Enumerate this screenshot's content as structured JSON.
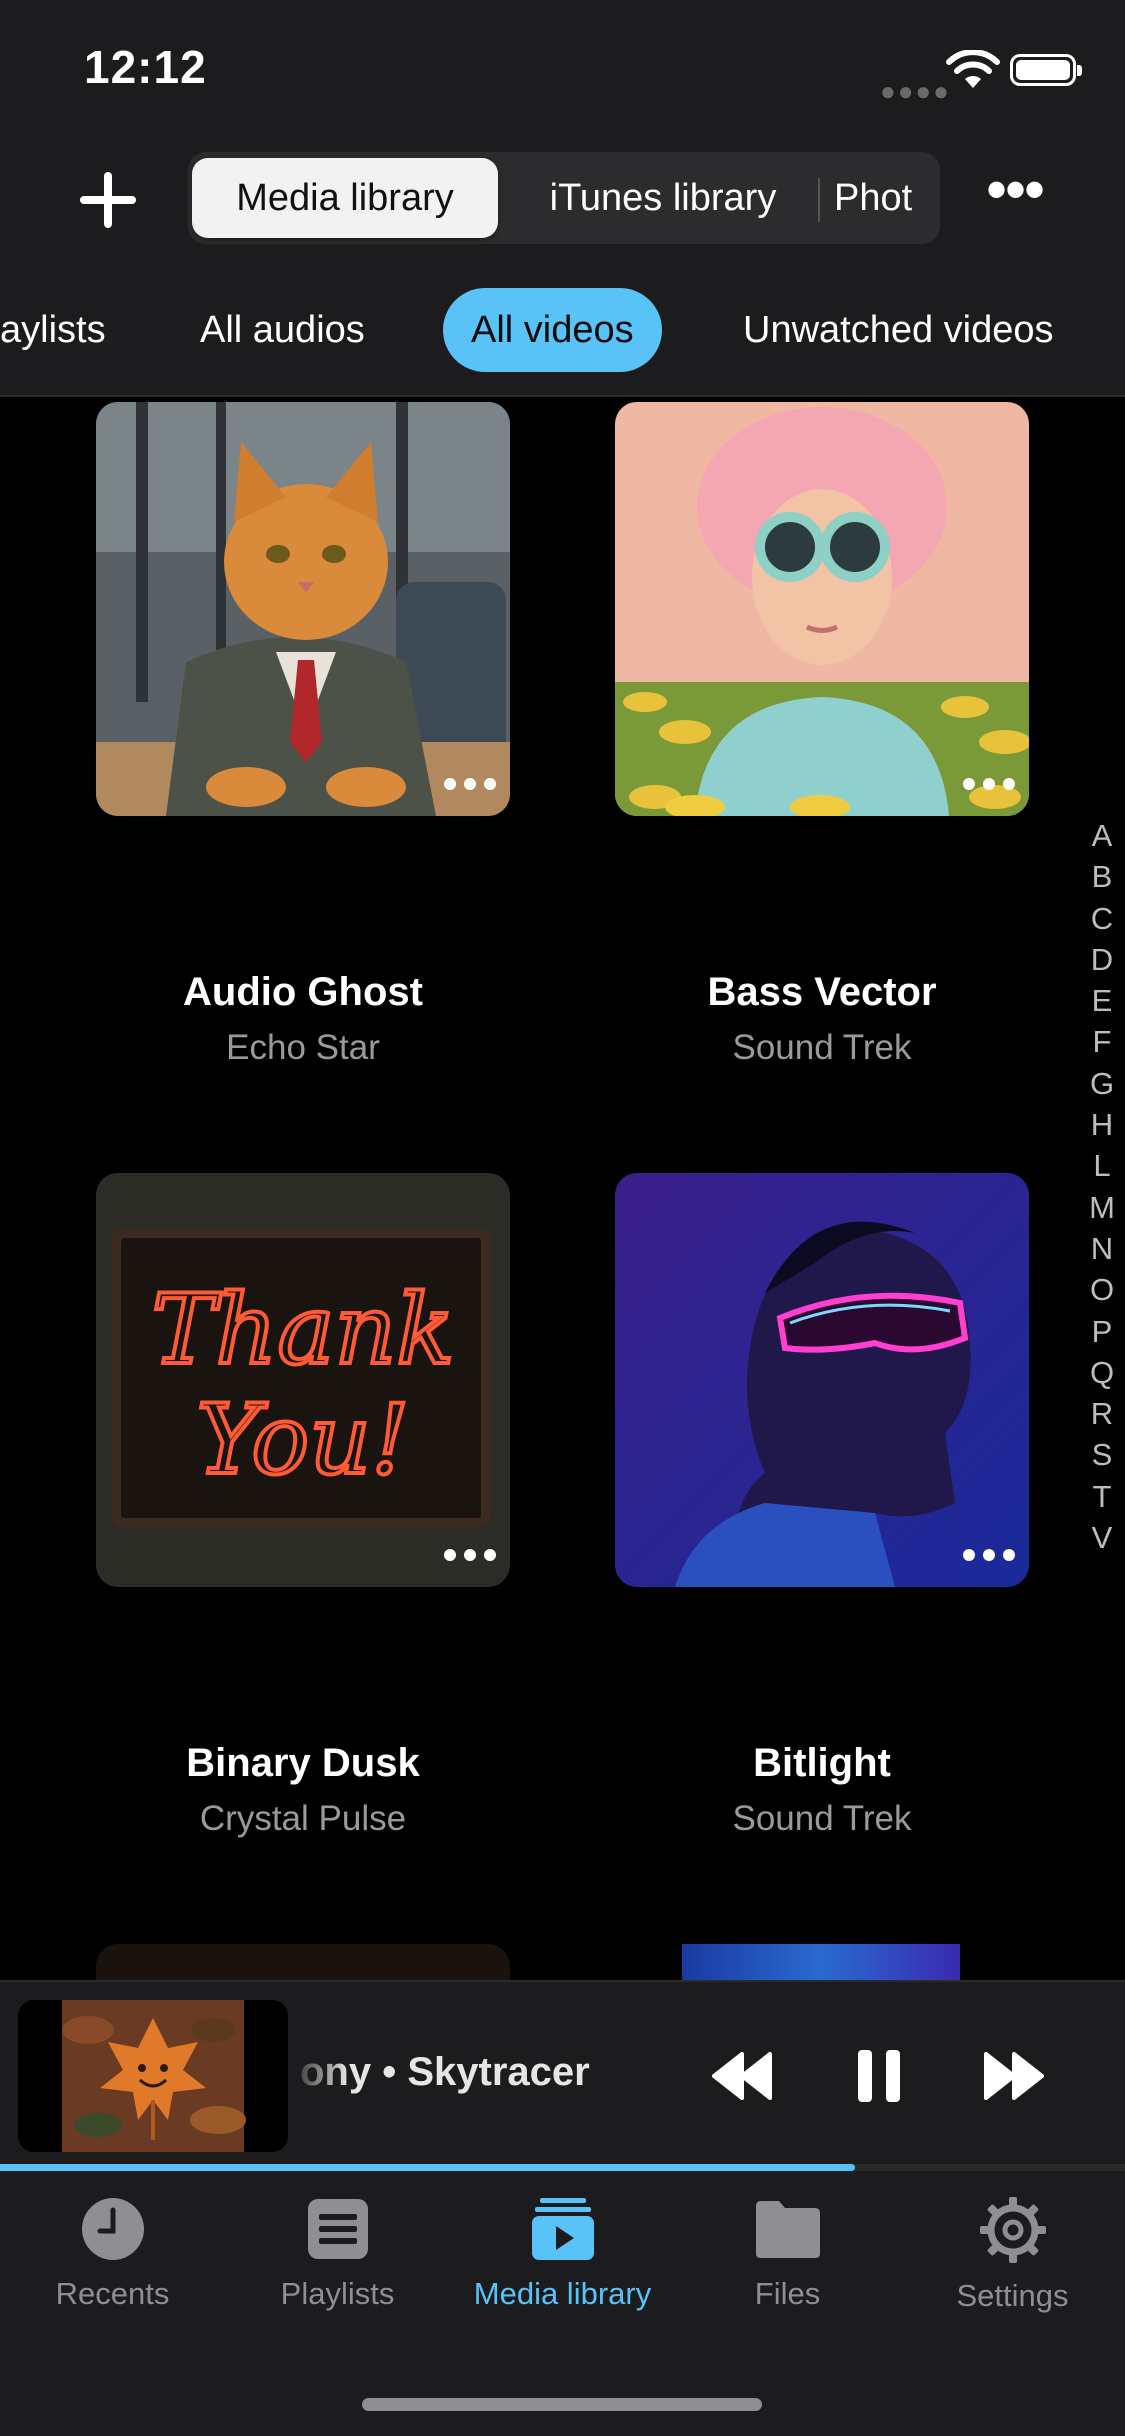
{
  "status_bar": {
    "time": "12:12"
  },
  "source_bar": {
    "add_icon": "plus-icon",
    "tabs": [
      "Media library",
      "iTunes library",
      "Phot"
    ],
    "active_tab": "Media library",
    "more_icon": "ellipsis-icon"
  },
  "filters": {
    "items": [
      "aylists",
      "All audios",
      "All videos",
      "Unwatched videos"
    ],
    "active": "All videos"
  },
  "grid": {
    "items": [
      {
        "title": "Audio Ghost",
        "subtitle": "Echo Star",
        "thumbnail": "cat-in-suit"
      },
      {
        "title": "Bass Vector",
        "subtitle": "Sound Trek",
        "thumbnail": "pink-hair-goggles"
      },
      {
        "title": "Binary Dusk",
        "subtitle": "Crystal Pulse",
        "thumbnail": "neon-sign"
      },
      {
        "title": "Bitlight",
        "subtitle": "Sound Trek",
        "thumbnail": "neon-visor-portrait"
      }
    ],
    "neon_sign_text": [
      "Thank",
      "You!"
    ]
  },
  "alpha_index": [
    "A",
    "B",
    "C",
    "D",
    "E",
    "F",
    "G",
    "H",
    "L",
    "M",
    "N",
    "O",
    "P",
    "Q",
    "R",
    "S",
    "T",
    "V"
  ],
  "mini_player": {
    "now_playing": "ony • Skytracer",
    "thumbnail": "maple-leaf-face",
    "progress": 0.76,
    "controls": [
      "rewind-icon",
      "pause-icon",
      "fast-forward-icon"
    ]
  },
  "tab_bar": {
    "items": [
      {
        "label": "Recents",
        "icon": "clock-icon"
      },
      {
        "label": "Playlists",
        "icon": "list-icon"
      },
      {
        "label": "Media library",
        "icon": "media-library-icon"
      },
      {
        "label": "Files",
        "icon": "folder-icon"
      },
      {
        "label": "Settings",
        "icon": "gear-icon"
      }
    ],
    "active": "Media library"
  },
  "colors": {
    "accent": "#59c2f7",
    "background": "#000000",
    "bar": "#1c1c1e"
  }
}
